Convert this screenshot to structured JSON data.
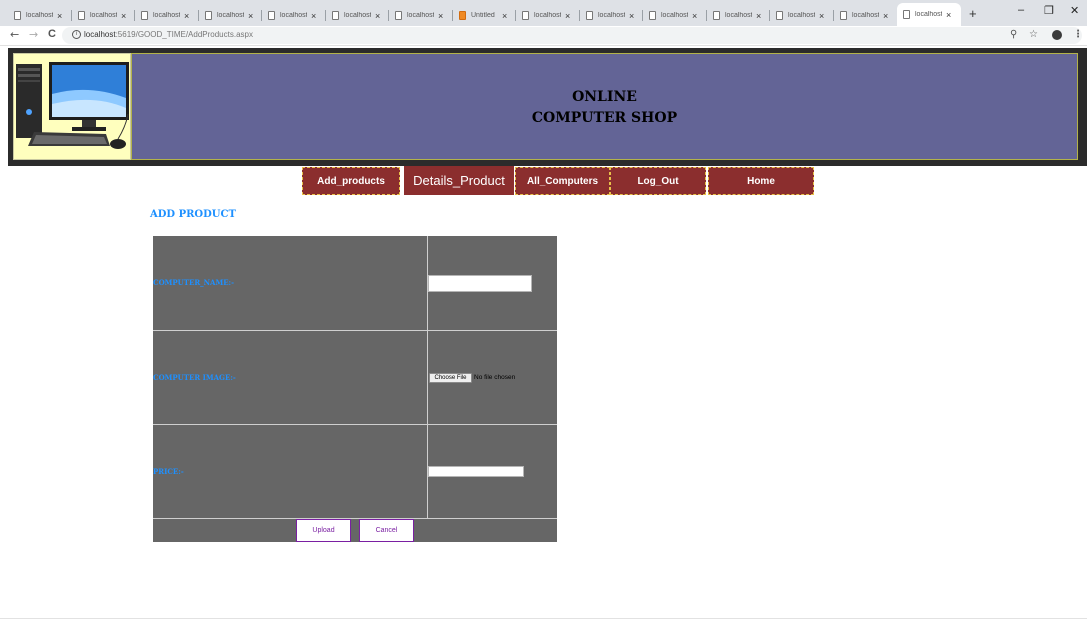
{
  "browser": {
    "tabs": [
      {
        "label": "localhost",
        "icon": "page-icon"
      },
      {
        "label": "localhost",
        "icon": "page-icon"
      },
      {
        "label": "localhost",
        "icon": "page-icon"
      },
      {
        "label": "localhost",
        "icon": "page-icon"
      },
      {
        "label": "localhost",
        "icon": "page-icon"
      },
      {
        "label": "localhost",
        "icon": "page-icon"
      },
      {
        "label": "localhost",
        "icon": "page-icon"
      },
      {
        "label": "Untitled",
        "icon": "orange-app-icon"
      },
      {
        "label": "localhost",
        "icon": "page-icon"
      },
      {
        "label": "localhost",
        "icon": "page-icon"
      },
      {
        "label": "localhost",
        "icon": "page-icon"
      },
      {
        "label": "localhost",
        "icon": "page-icon"
      },
      {
        "label": "localhost",
        "icon": "page-icon"
      },
      {
        "label": "localhost",
        "icon": "page-icon"
      },
      {
        "label": "localhost",
        "icon": "page-icon",
        "active": true
      }
    ],
    "tab_close": "×",
    "new_tab": "+",
    "window_controls": {
      "minimize": "–",
      "maximize": "❐",
      "close": "✕"
    },
    "nav": {
      "back": "←",
      "forward": "→",
      "reload": "C"
    },
    "url": {
      "host": "localhost",
      "rest": ":5619/GOOD_TIME/AddProducts.aspx"
    },
    "icons": {
      "zoom": "⚲",
      "star": "☆",
      "menu": "⋮"
    }
  },
  "banner": {
    "title_line1": "ONLINE",
    "title_line2": "COMPUTER SHOP",
    "colors": {
      "main": "#636496",
      "logo_bg": "#ffffbe",
      "frame": "#2b2b2b"
    }
  },
  "menu": [
    {
      "label": "Add_products"
    },
    {
      "label": "Details_Product"
    },
    {
      "label": "All_Computers"
    },
    {
      "label": "Log_Out"
    },
    {
      "label": "Home"
    }
  ],
  "page": {
    "heading": "ADD PRODUCT",
    "fields": {
      "name_label": "COMPUTER_NAME:-",
      "name_value": "",
      "image_label": "COMPUTER IMAGE:-",
      "file_button": "Choose File",
      "file_status": "No file chosen",
      "price_label": "PRICE:-",
      "price_value": ""
    },
    "buttons": {
      "upload": "Upload",
      "cancel": "Cancel"
    },
    "colors": {
      "label": "#1e90ff",
      "table_bg": "#666666",
      "menu_bg": "#8b2e2e",
      "button_border": "#7a1fa2"
    }
  }
}
